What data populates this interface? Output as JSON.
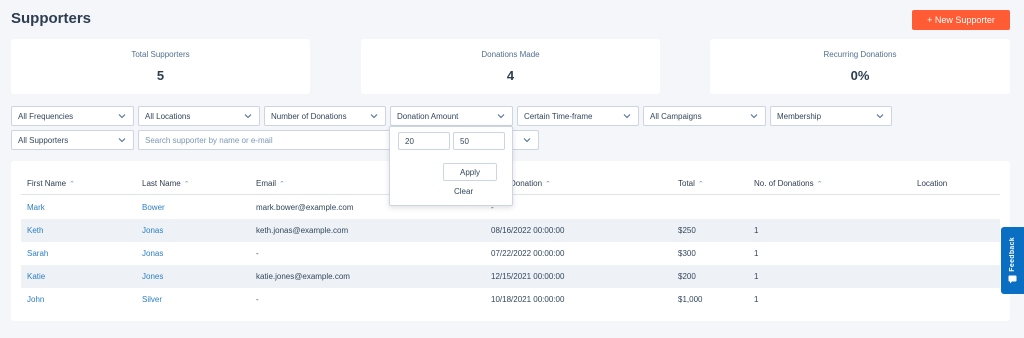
{
  "header": {
    "title": "Supporters",
    "new_button": "+ New Supporter"
  },
  "stats": [
    {
      "label": "Total Supporters",
      "value": "5"
    },
    {
      "label": "Donations Made",
      "value": "4"
    },
    {
      "label": "Recurring Donations",
      "value": "0%"
    }
  ],
  "filters": {
    "frequencies": "All Frequencies",
    "locations": "All Locations",
    "num_donations": "Number of Donations",
    "donation_amount": "Donation Amount",
    "timeframe": "Certain Time-frame",
    "campaigns": "All Campaigns",
    "membership": "Membership",
    "supporters": "All Supporters",
    "search_placeholder": "Search supporter by name or e-mail"
  },
  "popover": {
    "min": "20",
    "max": "50",
    "apply": "Apply",
    "clear": "Clear"
  },
  "table": {
    "headers": {
      "first_name": "First Name",
      "last_name": "Last Name",
      "email": "Email",
      "donation": "Donation",
      "total": "Total",
      "num_donations": "No. of Donations",
      "location": "Location"
    },
    "rows": [
      {
        "first": "Mark",
        "last": "Bower",
        "email": "mark.bower@example.com",
        "donation": "-",
        "total": "",
        "count": ""
      },
      {
        "first": "Keth",
        "last": "Jonas",
        "email": "keth.jonas@example.com",
        "donation": "08/16/2022 00:00:00",
        "total": "$250",
        "count": "1"
      },
      {
        "first": "Sarah",
        "last": "Jonas",
        "email": "-",
        "donation": "07/22/2022 00:00:00",
        "total": "$300",
        "count": "1"
      },
      {
        "first": "Katie",
        "last": "Jones",
        "email": "katie.jones@example.com",
        "donation": "12/15/2021 00:00:00",
        "total": "$200",
        "count": "1"
      },
      {
        "first": "John",
        "last": "Silver",
        "email": "-",
        "donation": "10/18/2021 00:00:00",
        "total": "$1,000",
        "count": "1"
      }
    ]
  },
  "feedback": {
    "label": "Feedback"
  },
  "colors": {
    "accent": "#ff5c35",
    "link": "#2d7fc1",
    "feedback": "#0a6fc2"
  }
}
